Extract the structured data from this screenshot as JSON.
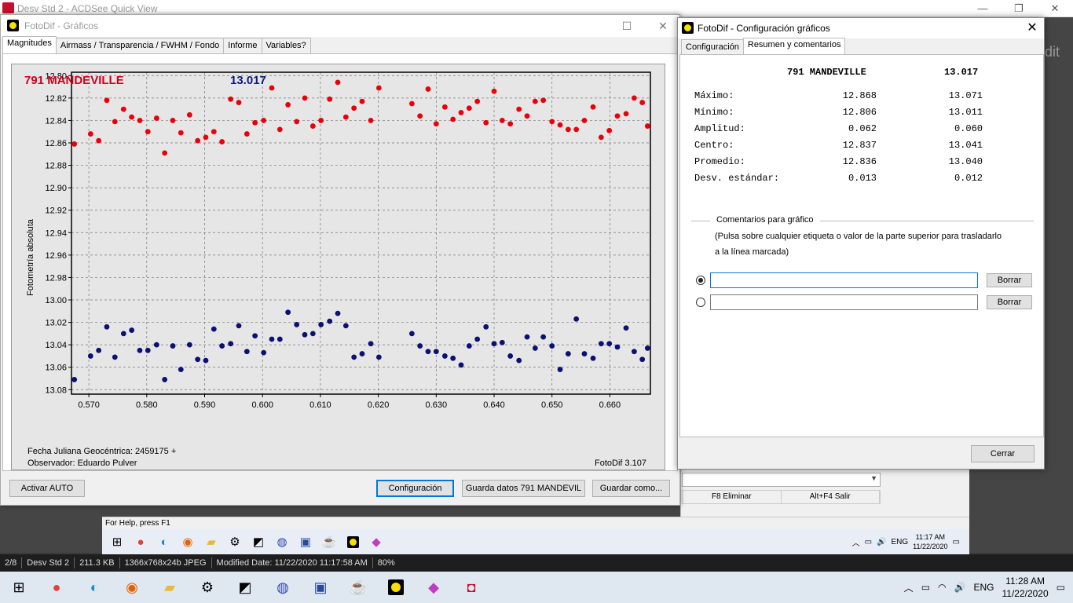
{
  "acdsee": {
    "title": "Desv Std 2 - ACDSee Quick View",
    "bg_fragment": "dit",
    "status": [
      "2/8",
      "Desv Std 2",
      "211.3 KB",
      "1366x768x24b JPEG",
      "Modified Date: 11/22/2020 11:17:58 AM",
      "80%"
    ]
  },
  "inner": {
    "help": "For Help, press F1",
    "fkeys": [
      "F8 Eliminar",
      "Alt+F4 Salir"
    ],
    "lang": "ENG",
    "time": "11:17 AM",
    "date": "11/22/2020"
  },
  "taskbar": {
    "lang": "ENG",
    "time": "11:28 AM",
    "date": "11/22/2020"
  },
  "graph_window": {
    "title": "FotoDif - Gráficos",
    "tabs": [
      "Magnitudes",
      "Airmass / Transparencia / FWHM / Fondo",
      "Informe",
      "Variables?"
    ],
    "star_name": "791 MANDEVILLE",
    "comp_value": "13.017",
    "ylabel": "Fotometría absoluta",
    "foot1": "Fecha Juliana Geocéntrica: 2459175 +",
    "foot2": "Observador: Eduardo Pulver",
    "version": "FotoDif 3.107",
    "buttons": {
      "auto": "Activar AUTO",
      "config": "Configuración",
      "save_data": "Guarda datos 791 MANDEVIL",
      "save_as": "Guardar como..."
    }
  },
  "config_window": {
    "title": "FotoDif - Configuración gráficos",
    "tabs": [
      "Configuración",
      "Resumen y comentarios"
    ],
    "header_name": "791 MANDEVILLE",
    "header_value": "13.017",
    "stats": [
      {
        "label": "Máximo:",
        "v1": "12.868",
        "v2": "13.071"
      },
      {
        "label": "Mínimo:",
        "v1": "12.806",
        "v2": "13.011"
      },
      {
        "label": "Amplitud:",
        "v1": "0.062",
        "v2": "0.060"
      },
      {
        "label": "Centro:",
        "v1": "12.837",
        "v2": "13.041"
      },
      {
        "label": "Promedio:",
        "v1": "12.836",
        "v2": "13.040"
      },
      {
        "label": "Desv. estándar:",
        "v1": "0.013",
        "v2": "0.012"
      }
    ],
    "comments_title": "Comentarios para gráfico",
    "comments_help1": "(Pulsa sobre cualquier etiqueta o valor de la parte superior para trasladarlo",
    "comments_help2": "a la línea marcada)",
    "comment1": "",
    "comment2": "",
    "clear_label": "Borrar",
    "close_label": "Cerrar"
  },
  "chart_data": {
    "type": "scatter",
    "xlim": [
      0.567,
      0.667
    ],
    "ylim": [
      13.084,
      12.797
    ],
    "xticks": [
      "0.570",
      "0.580",
      "0.590",
      "0.600",
      "0.610",
      "0.620",
      "0.630",
      "0.640",
      "0.650",
      "0.660"
    ],
    "yticks": [
      "12.80",
      "12.82",
      "12.84",
      "12.86",
      "12.88",
      "12.90",
      "12.92",
      "12.94",
      "12.96",
      "12.98",
      "13.00",
      "13.02",
      "13.04",
      "13.06",
      "13.08"
    ],
    "grid": true,
    "series": [
      {
        "color": "#e8000b",
        "x": [
          0.5675,
          0.5703,
          0.5717,
          0.5731,
          0.5745,
          0.576,
          0.5774,
          0.5788,
          0.5802,
          0.5817,
          0.5831,
          0.5845,
          0.5859,
          0.5874,
          0.5888,
          0.5902,
          0.5916,
          0.593,
          0.5945,
          0.5959,
          0.5973,
          0.5987,
          0.6002,
          0.6016,
          0.603,
          0.6044,
          0.6059,
          0.6073,
          0.6087,
          0.6101,
          0.6116,
          0.613,
          0.6144,
          0.6158,
          0.6172,
          0.6187,
          0.6201,
          0.6258,
          0.6272,
          0.6286,
          0.63,
          0.6315,
          0.6329,
          0.6343,
          0.6357,
          0.6371,
          0.6386,
          0.64,
          0.6414,
          0.6428,
          0.6443,
          0.6457,
          0.6471,
          0.6485,
          0.65,
          0.6514,
          0.6528,
          0.6542,
          0.6556,
          0.6571,
          0.6585,
          0.6599,
          0.6613,
          0.6628,
          0.6642,
          0.6656,
          0.6665
        ],
        "y": [
          12.861,
          12.852,
          12.858,
          12.822,
          12.841,
          12.83,
          12.837,
          12.84,
          12.85,
          12.838,
          12.869,
          12.84,
          12.851,
          12.835,
          12.858,
          12.855,
          12.85,
          12.859,
          12.821,
          12.824,
          12.852,
          12.842,
          12.84,
          12.811,
          12.848,
          12.826,
          12.841,
          12.82,
          12.845,
          12.84,
          12.821,
          12.806,
          12.837,
          12.829,
          12.823,
          12.84,
          12.811,
          12.825,
          12.836,
          12.812,
          12.843,
          12.828,
          12.839,
          12.833,
          12.829,
          12.823,
          12.842,
          12.814,
          12.84,
          12.843,
          12.83,
          12.836,
          12.823,
          12.822,
          12.841,
          12.844,
          12.848,
          12.848,
          12.84,
          12.828,
          12.855,
          12.849,
          12.836,
          12.834,
          12.82,
          12.824,
          12.845
        ]
      },
      {
        "color": "#0a1172",
        "x": [
          0.5675,
          0.5703,
          0.5717,
          0.5731,
          0.5745,
          0.576,
          0.5774,
          0.5788,
          0.5802,
          0.5817,
          0.5831,
          0.5845,
          0.5859,
          0.5874,
          0.5888,
          0.5902,
          0.5916,
          0.593,
          0.5945,
          0.5959,
          0.5973,
          0.5987,
          0.6002,
          0.6016,
          0.603,
          0.6044,
          0.6059,
          0.6073,
          0.6087,
          0.6101,
          0.6116,
          0.613,
          0.6144,
          0.6158,
          0.6172,
          0.6187,
          0.6201,
          0.6258,
          0.6272,
          0.6286,
          0.63,
          0.6315,
          0.6329,
          0.6343,
          0.6357,
          0.6371,
          0.6386,
          0.64,
          0.6414,
          0.6428,
          0.6443,
          0.6457,
          0.6471,
          0.6485,
          0.65,
          0.6514,
          0.6528,
          0.6542,
          0.6556,
          0.6571,
          0.6585,
          0.6599,
          0.6613,
          0.6628,
          0.6642,
          0.6656,
          0.6665
        ],
        "y": [
          13.071,
          13.05,
          13.045,
          13.024,
          13.051,
          13.03,
          13.027,
          13.045,
          13.045,
          13.04,
          13.071,
          13.041,
          13.062,
          13.04,
          13.053,
          13.054,
          13.026,
          13.041,
          13.039,
          13.023,
          13.046,
          13.032,
          13.047,
          13.035,
          13.035,
          13.011,
          13.022,
          13.031,
          13.03,
          13.022,
          13.019,
          13.012,
          13.023,
          13.051,
          13.048,
          13.039,
          13.051,
          13.03,
          13.041,
          13.046,
          13.046,
          13.05,
          13.052,
          13.058,
          13.041,
          13.035,
          13.024,
          13.039,
          13.038,
          13.05,
          13.054,
          13.033,
          13.043,
          13.033,
          13.041,
          13.062,
          13.048,
          13.017,
          13.048,
          13.052,
          13.039,
          13.039,
          13.042,
          13.025,
          13.046,
          13.053,
          13.043
        ]
      }
    ]
  }
}
